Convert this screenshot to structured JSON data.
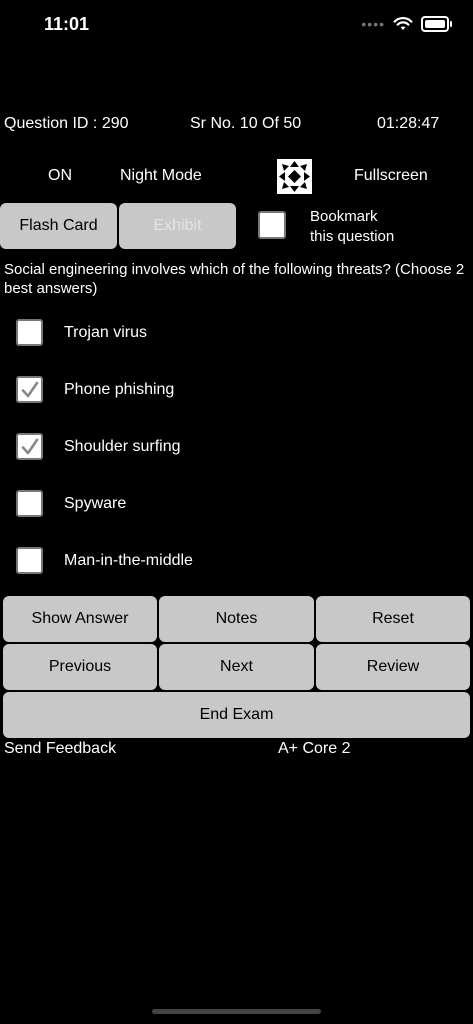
{
  "status_bar": {
    "time": "11:01",
    "signal_icon": "signal-dots-icon",
    "wifi_icon": "wifi-icon",
    "battery_icon": "battery-icon"
  },
  "exam_info": {
    "question_id": "Question ID : 290",
    "serial": "Sr No. 10 Of 50",
    "timer": "01:28:47"
  },
  "mode": {
    "status": "ON",
    "label": "Night Mode",
    "fullscreen_icon": "fullscreen-arrows-icon",
    "fullscreen_label": "Fullscreen"
  },
  "actions": {
    "flash_card": "Flash Card",
    "exhibit": "Exhibit",
    "bookmark_line1": "Bookmark",
    "bookmark_line2": "this question",
    "bookmark_checked": false
  },
  "question": {
    "text": "Social engineering involves which of the following threats? (Choose 2 best answers)",
    "options": [
      {
        "label": "Trojan virus",
        "checked": false
      },
      {
        "label": "Phone phishing",
        "checked": true
      },
      {
        "label": "Shoulder surfing",
        "checked": true
      },
      {
        "label": "Spyware",
        "checked": false
      },
      {
        "label": "Man-in-the-middle",
        "checked": false
      }
    ]
  },
  "controls": {
    "show_answer": "Show Answer",
    "notes": "Notes",
    "reset": "Reset",
    "previous": "Previous",
    "next": "Next",
    "review": "Review",
    "end_exam": "End Exam"
  },
  "footer": {
    "feedback": "Send Feedback",
    "exam_name": "A+ Core 2"
  },
  "colors": {
    "background": "#000000",
    "button": "#c8c8c8",
    "text": "#ffffff"
  }
}
